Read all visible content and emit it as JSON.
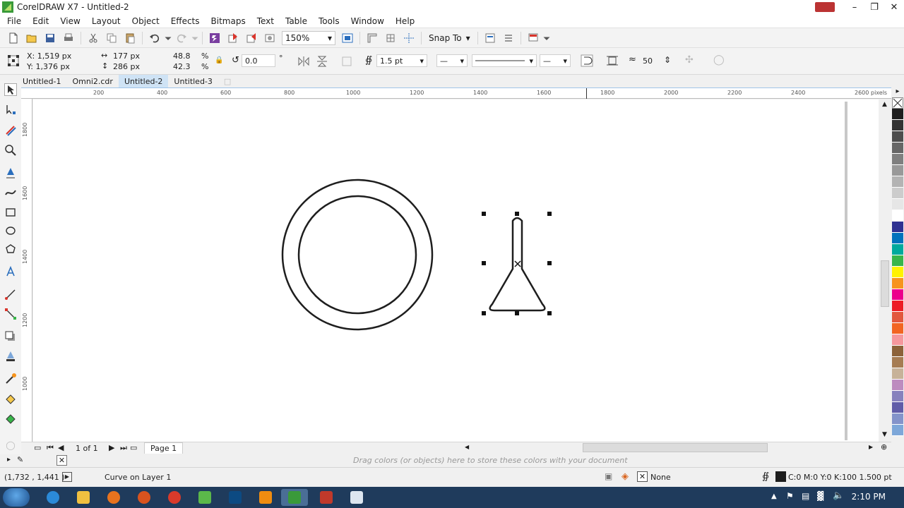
{
  "window": {
    "title": "CorelDRAW X7 - Untitled-2"
  },
  "menu": [
    "File",
    "Edit",
    "View",
    "Layout",
    "Object",
    "Effects",
    "Bitmaps",
    "Text",
    "Table",
    "Tools",
    "Window",
    "Help"
  ],
  "toolbar": {
    "zoom": "150%",
    "snap_label": "Snap To"
  },
  "properties": {
    "x": "X: 1,519 px",
    "y": "Y: 1,376 px",
    "width": "177 px",
    "height": "286 px",
    "scale_w": "48.8",
    "scale_h": "42.3",
    "percent": "%",
    "rotation": "0.0",
    "degree": "°",
    "outline_width": "1.5 pt",
    "smoothing": "50"
  },
  "tabs": [
    {
      "label": "Untitled-1",
      "active": false
    },
    {
      "label": "Omni2.cdr",
      "active": false
    },
    {
      "label": "Untitled-2",
      "active": true
    },
    {
      "label": "Untitled-3",
      "active": false
    }
  ],
  "ruler": {
    "h_labels": [
      "200",
      "400",
      "600",
      "800",
      "1000",
      "1200",
      "1400",
      "1600",
      "1800",
      "2000",
      "2200",
      "2400",
      "2600"
    ],
    "h_unit": "pixels",
    "v_labels": [
      "1800",
      "1600",
      "1400",
      "1200",
      "1000"
    ]
  },
  "page_nav": {
    "page_count": "1 of 1",
    "page_tab": "Page 1"
  },
  "doc_palette_hint": "Drag colors (or objects) here to store these colors with your document",
  "status": {
    "cursor": "(1,732 , 1,441 )",
    "object": "Curve on Layer 1",
    "fill": "None",
    "outline": "C:0 M:0 Y:0 K:100  1.500 pt"
  },
  "clock": "2:10 PM",
  "palette_colors": [
    "#1e1e1e",
    "#333333",
    "#4d4d4d",
    "#666666",
    "#7f7f7f",
    "#999999",
    "#b3b3b3",
    "#cccccc",
    "#e6e6e6",
    "#ffffff",
    "#2e3192",
    "#0072bc",
    "#00a99d",
    "#39b54a",
    "#fff200",
    "#f7941d",
    "#ec008c",
    "#ed1c24",
    "#e2583e",
    "#f26522",
    "#f5989d",
    "#8c6239",
    "#a67c52",
    "#c7b299",
    "#bd8cbf",
    "#8781bd",
    "#605ca8",
    "#8393ca",
    "#7da7d9"
  ]
}
